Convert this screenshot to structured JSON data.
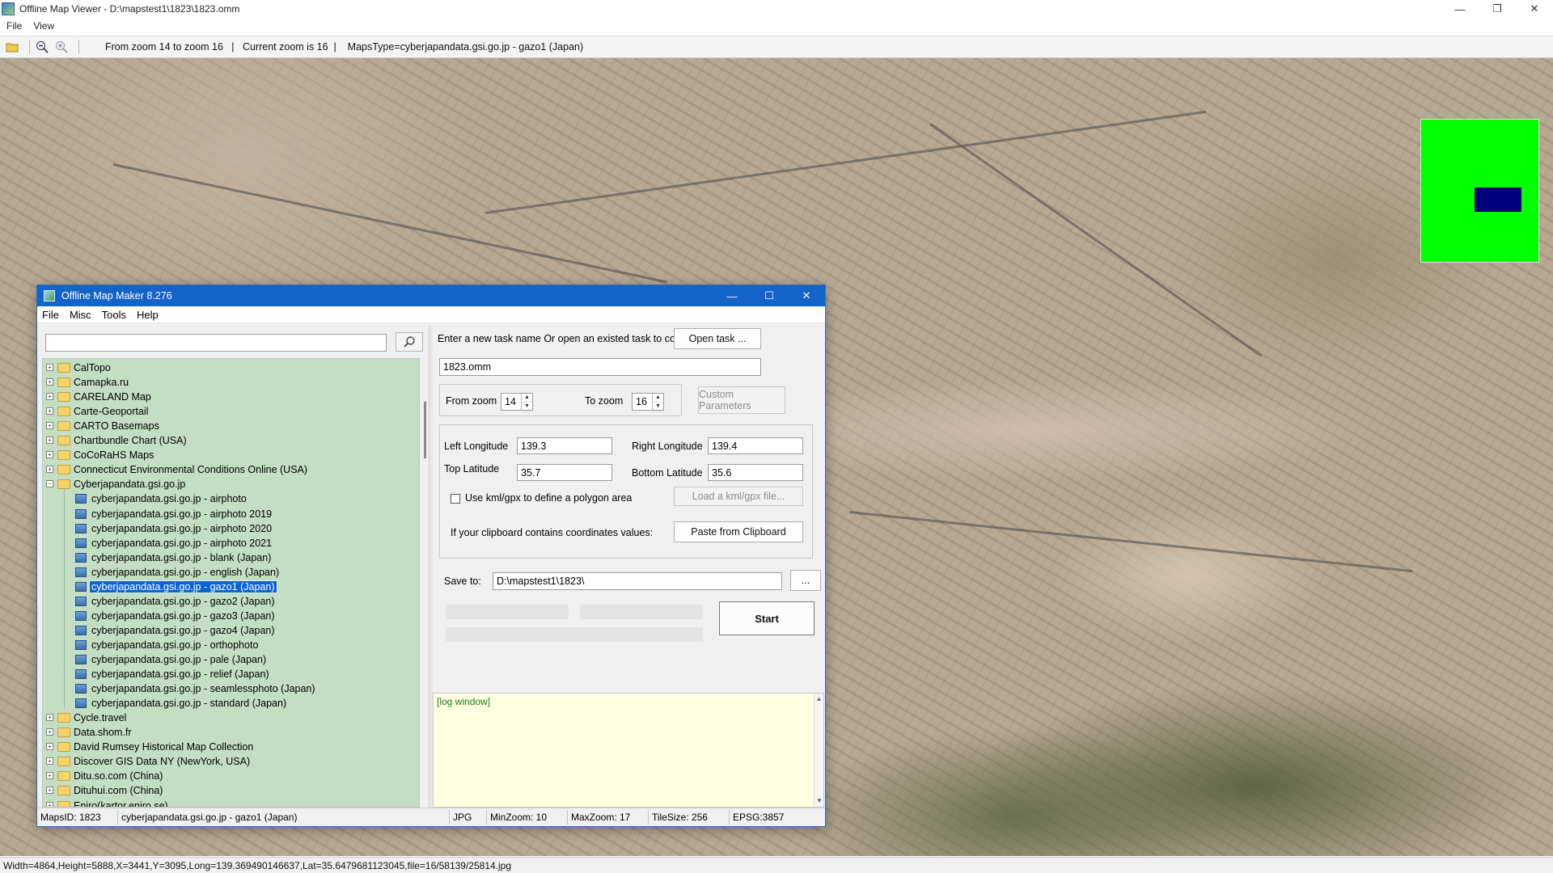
{
  "viewer": {
    "title": "Offline Map Viewer - D:\\mapstest1\\1823\\1823.omm",
    "window_controls": {
      "minimize": "—",
      "restore": "❐",
      "close": "✕"
    },
    "menu": [
      "File",
      "View"
    ],
    "toolbar": {
      "icons": [
        "open-folder-icon",
        "zoom-out-icon",
        "zoom-in-icon"
      ],
      "info": "From zoom 14 to zoom 16   |   Current zoom is 16  |    MapsType=cyberjapandata.gsi.go.jp - gazo1 (Japan)"
    },
    "status": "Width=4864,Height=5888,X=3441,Y=3095,Long=139.369490146637,Lat=35.6479681123045,file=16/58139/25814.jpg",
    "minimap_colors": {
      "background": "#00ff00",
      "viewport": "#00007a"
    }
  },
  "dialog": {
    "title": "Offline Map Maker 8.276",
    "window_controls": {
      "minimize": "—",
      "maximize": "☐",
      "close": "✕"
    },
    "menu": [
      "File",
      "Misc",
      "Tools",
      "Help"
    ],
    "search": {
      "value": "",
      "button_icon": "search-icon"
    },
    "tree": [
      {
        "label": "CalTopo",
        "type": "folder",
        "expanded": false
      },
      {
        "label": "Camapka.ru",
        "type": "folder",
        "expanded": false
      },
      {
        "label": "CARELAND Map",
        "type": "folder",
        "expanded": false
      },
      {
        "label": "Carte-Geoportail",
        "type": "folder",
        "expanded": false
      },
      {
        "label": "CARTO Basemaps",
        "type": "folder",
        "expanded": false
      },
      {
        "label": "Chartbundle Chart (USA)",
        "type": "folder",
        "expanded": false
      },
      {
        "label": "CoCoRaHS Maps",
        "type": "folder",
        "expanded": false
      },
      {
        "label": "Connecticut Environmental Conditions Online (USA)",
        "type": "folder",
        "expanded": false
      },
      {
        "label": "Cyberjapandata.gsi.go.jp",
        "type": "folder",
        "expanded": true
      },
      {
        "label": "cyberjapandata.gsi.go.jp - airphoto",
        "type": "map"
      },
      {
        "label": "cyberjapandata.gsi.go.jp - airphoto 2019",
        "type": "map"
      },
      {
        "label": "cyberjapandata.gsi.go.jp - airphoto 2020",
        "type": "map"
      },
      {
        "label": "cyberjapandata.gsi.go.jp - airphoto 2021",
        "type": "map"
      },
      {
        "label": "cyberjapandata.gsi.go.jp - blank (Japan)",
        "type": "map"
      },
      {
        "label": "cyberjapandata.gsi.go.jp - english (Japan)",
        "type": "map"
      },
      {
        "label": "cyberjapandata.gsi.go.jp - gazo1 (Japan)",
        "type": "map",
        "selected": true
      },
      {
        "label": "cyberjapandata.gsi.go.jp - gazo2 (Japan)",
        "type": "map"
      },
      {
        "label": "cyberjapandata.gsi.go.jp - gazo3 (Japan)",
        "type": "map"
      },
      {
        "label": "cyberjapandata.gsi.go.jp - gazo4 (Japan)",
        "type": "map"
      },
      {
        "label": "cyberjapandata.gsi.go.jp - orthophoto",
        "type": "map"
      },
      {
        "label": "cyberjapandata.gsi.go.jp - pale (Japan)",
        "type": "map"
      },
      {
        "label": "cyberjapandata.gsi.go.jp - relief (Japan)",
        "type": "map"
      },
      {
        "label": "cyberjapandata.gsi.go.jp - seamlessphoto (Japan)",
        "type": "map"
      },
      {
        "label": "cyberjapandata.gsi.go.jp - standard (Japan)",
        "type": "map"
      },
      {
        "label": "Cycle.travel",
        "type": "folder",
        "expanded": false
      },
      {
        "label": "Data.shom.fr",
        "type": "folder",
        "expanded": false
      },
      {
        "label": "David Rumsey Historical Map Collection",
        "type": "folder",
        "expanded": false
      },
      {
        "label": "Discover GIS Data NY (NewYork, USA)",
        "type": "folder",
        "expanded": false
      },
      {
        "label": "Ditu.so.com (China)",
        "type": "folder",
        "expanded": false
      },
      {
        "label": "Dituhui.com (China)",
        "type": "folder",
        "expanded": false
      },
      {
        "label": "Eniro(kartor.eniro.se)",
        "type": "folder",
        "expanded": false
      }
    ],
    "form": {
      "task_prompt": "Enter a new task name Or open an existed task to continue:",
      "open_task_label": "Open task ...",
      "task_name": "1823.omm",
      "from_zoom_label": "From zoom",
      "from_zoom": "14",
      "to_zoom_label": "To zoom",
      "to_zoom": "16",
      "custom_params_label": "Custom Parameters",
      "left_long_label": "Left Longitude",
      "left_long": "139.3",
      "right_long_label": "Right Longitude",
      "right_long": "139.4",
      "top_lat_label": "Top Latitude",
      "top_lat": "35.7",
      "bottom_lat_label": "Bottom Latitude",
      "bottom_lat": "35.6",
      "kml_checkbox_label": "Use kml/gpx to define a polygon area",
      "kml_checked": false,
      "load_kml_label": "Load a kml/gpx file...",
      "clipboard_prompt": "If your clipboard contains coordinates values:",
      "paste_label": "Paste from Clipboard",
      "save_to_label": "Save to:",
      "save_to": "D:\\mapstest1\\1823\\",
      "browse_label": "...",
      "start_label": "Start",
      "log_label": "[log window]",
      "progress": [
        0,
        0,
        0
      ]
    },
    "status": {
      "maps_id": "MapsID: 1823",
      "maps_name": "cyberjapandata.gsi.go.jp - gazo1 (Japan)",
      "format": "JPG",
      "min_zoom": "MinZoom: 10",
      "max_zoom": "MaxZoom: 17",
      "tile_size": "TileSize: 256",
      "epsg": "EPSG:3857"
    }
  }
}
